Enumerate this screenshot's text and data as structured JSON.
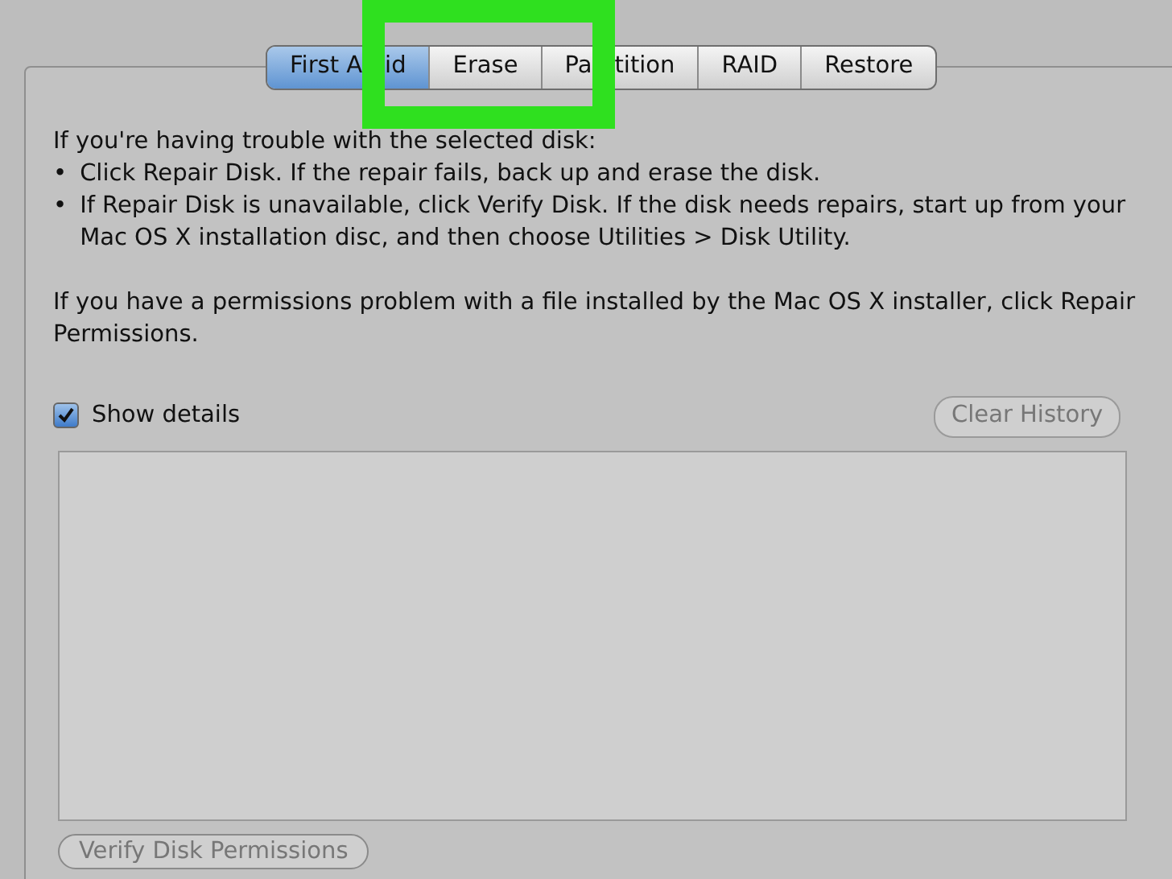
{
  "tabs": [
    {
      "label_parts": [
        "First A",
        "id"
      ],
      "selected": true
    },
    {
      "label_parts": [
        "Erase"
      ],
      "selected": false
    },
    {
      "label_parts": [
        "Pa",
        "tition"
      ],
      "selected": false
    },
    {
      "label_parts": [
        "RAID"
      ],
      "selected": false
    },
    {
      "label_parts": [
        "Restore"
      ],
      "selected": false
    }
  ],
  "intro": "If you're having trouble with the selected disk:",
  "bullets": [
    {
      "marker": "•",
      "text": "Click Repair Disk. If the repair fails, back up and erase the disk."
    },
    {
      "marker": "•",
      "text": "If Repair Disk is unavailable, click Verify Disk. If the disk needs repairs, start up from your Mac OS X installation disc, and then choose Utilities > Disk Utility."
    }
  ],
  "permissions_note": "If you have a permissions problem with a file installed by the Mac OS X installer, click Repair Permissions.",
  "show_details": {
    "label": "Show details",
    "checked": true
  },
  "clear_history_button": "Clear History",
  "bottom_buttons": [
    "Verify Disk Permissions"
  ],
  "highlight": {
    "color": "#2fe01f"
  }
}
